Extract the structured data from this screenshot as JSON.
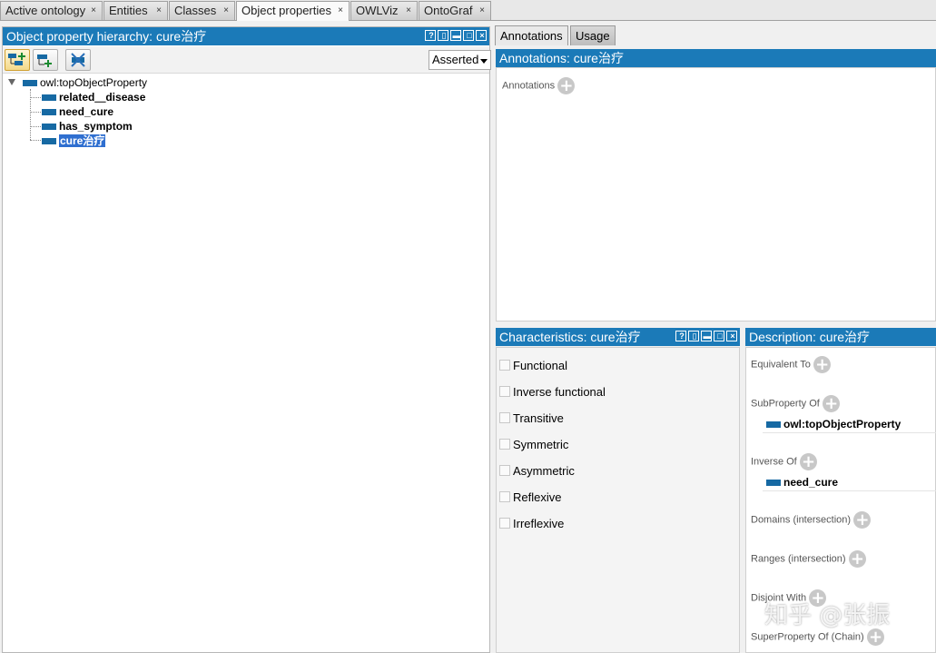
{
  "top_tabs": [
    {
      "label": "Active ontology"
    },
    {
      "label": "Entities"
    },
    {
      "label": "Classes"
    },
    {
      "label": "Object properties"
    },
    {
      "label": "OWLViz"
    },
    {
      "label": "OntoGraf"
    }
  ],
  "close_glyph": "×",
  "hierarchy": {
    "title": "Object property hierarchy: cure治疗",
    "view_select": "Asserted",
    "root": "owl:topObjectProperty",
    "children": [
      "related＿disease",
      "need_cure",
      "has_symptom",
      "cure治疗"
    ],
    "selected": "cure治疗",
    "icons": [
      "add-subproperty-icon",
      "add-sibling-property-icon",
      "delete-property-icon"
    ]
  },
  "right_tabs": [
    {
      "label": "Annotations"
    },
    {
      "label": "Usage"
    }
  ],
  "annotations": {
    "title": "Annotations: cure治疗",
    "label": "Annotations"
  },
  "characteristics": {
    "title": "Characteristics: cure治疗",
    "items": [
      "Functional",
      "Inverse functional",
      "Transitive",
      "Symmetric",
      "Asymmetric",
      "Reflexive",
      "Irreflexive"
    ]
  },
  "description": {
    "title": "Description: cure治疗",
    "sections": [
      "Equivalent To",
      "SubProperty Of",
      "Inverse Of",
      "Domains (intersection)",
      "Ranges (intersection)",
      "Disjoint With",
      "SuperProperty Of (Chain)"
    ],
    "subproperty_of_value": "owl:topObjectProperty",
    "inverse_of_value": "need_cure"
  },
  "window_buttons": [
    "?",
    "▯",
    "▬",
    "□",
    "×"
  ],
  "watermark": "知乎 @张振",
  "colors": {
    "header_blue": "#1b7ab8",
    "property_icon": "#1669a3",
    "selection": "#2f6fd0"
  }
}
